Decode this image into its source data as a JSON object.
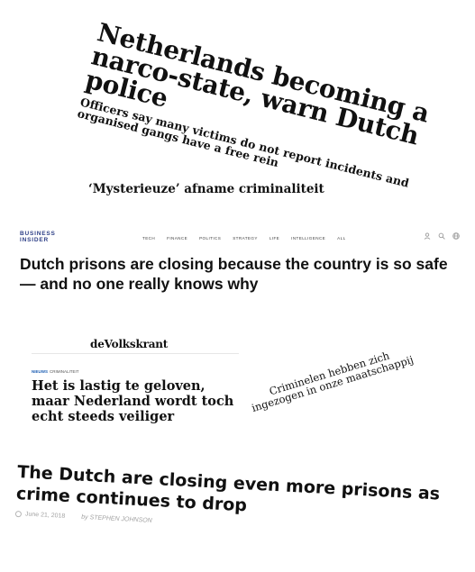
{
  "clip1": {
    "headline": "Netherlands becoming a narco-state, warn Dutch police",
    "subheading": "Officers say many victims do not report incidents and organised gangs have a free rein"
  },
  "clip2": {
    "headline": "‘Mysterieuze’ afname criminaliteit"
  },
  "business_insider": {
    "logo": "BUSINESS\nINSIDER",
    "nav": [
      "TECH",
      "FINANCE",
      "POLITICS",
      "STRATEGY",
      "LIFE",
      "INTELLIGENCE",
      "ALL"
    ],
    "headline": "Dutch prisons are closing because the country is so safe — and no one really knows why",
    "icons": [
      "user-icon",
      "search-icon",
      "globe-icon"
    ]
  },
  "volkskrant": {
    "logo": "deVolkskrant",
    "tag_section": "NIEUWS",
    "tag_topic": "CRIMINALITEIT",
    "headline": "Het is lastig te geloven, maar Nederland wordt toch echt steeds veiliger"
  },
  "quote": {
    "text": "Criminelen hebben zich ingezogen in onze maatschappij"
  },
  "clip6": {
    "headline": "The Dutch are closing even more prisons as crime continues to drop",
    "date": "June 21, 2018",
    "byline": "by STEPHEN JOHNSON"
  }
}
